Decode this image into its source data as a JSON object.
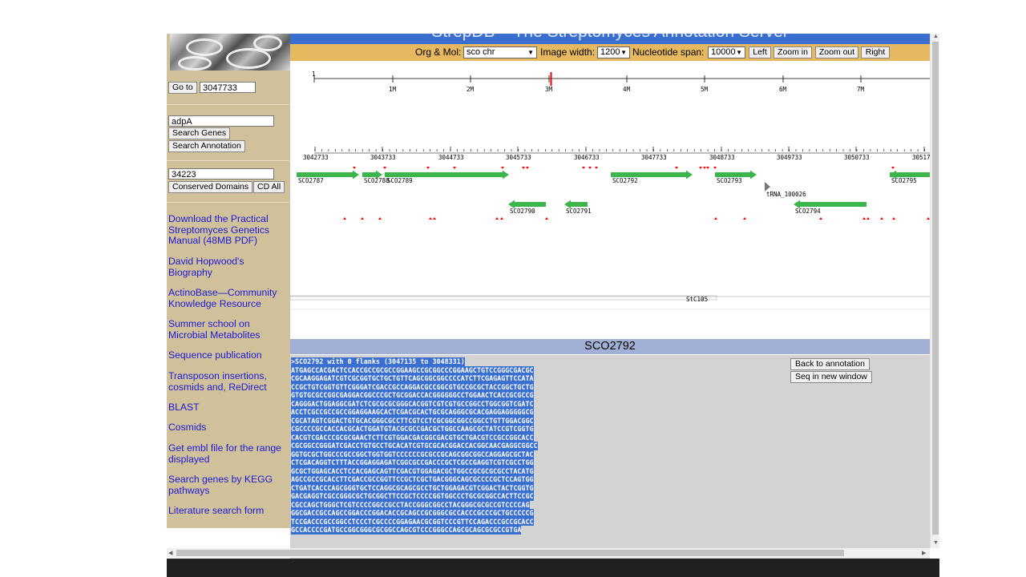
{
  "header": {
    "title": "StrepDB – The Streptomyces Annotation Server"
  },
  "controls": {
    "org_label": "Org & Mol:",
    "org_value": "sco chr",
    "width_label": "Image width:",
    "width_value": "1200",
    "span_label": "Nucleotide span:",
    "span_value": "10000",
    "left": "Left",
    "zoom_in": "Zoom in",
    "zoom_out": "Zoom out",
    "right": "Right"
  },
  "sidebar": {
    "goto_button": "Go to",
    "goto_value": "3047733",
    "gene_query": "adpA",
    "search_genes": "Search Genes",
    "search_annotation": "Search Annotation",
    "domain_query": "34223",
    "conserved_domains": "Conserved Domains",
    "cd_all": "CD All",
    "links": [
      "Download the Practical Streptomyces Genetics Manual (48MB PDF)",
      "David Hopwood's Biography",
      "ActinoBase—Community Knowledge Resource",
      "Summer school on Microbial Metabolites",
      "Sequence publication",
      "Transposon insertions, cosmids and, ReDirect",
      "BLAST",
      "Cosmids",
      "Get embl file for the range displayed",
      "Search genes by KEGG pathways",
      "Literature search form"
    ]
  },
  "genome_ruler": {
    "start_label": "1",
    "ticks": [
      "1M",
      "2M",
      "3M",
      "4M",
      "5M",
      "6M",
      "7M"
    ]
  },
  "local_ruler": {
    "ticks": [
      "3042733",
      "3043733",
      "3044733",
      "3045733",
      "3046733",
      "3047733",
      "3048733",
      "3049733",
      "3050733",
      "30517"
    ]
  },
  "genes_forward": [
    {
      "label": "SCO2787"
    },
    {
      "label": "SCO2788"
    },
    {
      "label": "SCO2789"
    },
    {
      "label": "SCO2792"
    },
    {
      "label": "SCO2793"
    },
    {
      "label": "SCO2795"
    }
  ],
  "genes_reverse": [
    {
      "label": "SCO2790"
    },
    {
      "label": "SCO2791"
    },
    {
      "label": "SCO2794"
    }
  ],
  "trna_label": "tRNA_100026",
  "cosmid_label": "StC105",
  "colors": {
    "gene": "#3cb54a",
    "marker": "#ff0000",
    "header_bar": "#3a6fd0",
    "control_bar": "#e6b85f",
    "sidebar": "#d1c19a",
    "section_bar": "#a3b0d6"
  },
  "sequence_panel": {
    "title": "SCO2792",
    "back_button": "Back to annotation",
    "new_window_button": "Seq in new window",
    "fasta_header": ">SCO2792 with 0 flanks (3047135 to 3048331)",
    "lines": [
      "ATGAGCCACGACTCCACCGCCGCGCCGGAAGCCGCGGCCCGGAAGCTGTCCGGGCGACGC",
      "CGCAAGGAGATCGTCGCGGTGCTGCTGTTCAGCGGCGGCCCCATCTTCGAGAGTTCCATA",
      "CCGCTGTCGGTGTTCGGGATCGACCGCCAGGACGCCGGCGTGCCGCGCTACCGGCTGCTG",
      "GTGTGCGCCGGCGAGGACGGCCCGCTGCGGACCACGGGGGGCCTGGAACTCACCGCGCCG",
      "CAGGGACTGGAGGCGATCTCGCGCGCGGGCACGGTCGTCGTGCCGGCCTGGCGGTCGATC",
      "ACCTCGCCGCCGCCGGAGGAAGCACTCGACGCACTGCGCAGGGCGCACGAGGAGGGGGCG",
      "CGCATAGTCGGACTGTGCACGGGCGCCTTCGTCCTCGCGGCGGCCGGCCTGTTGGACGGC",
      "CGCCCCGCCACCACGCACTGGATGTACGCGCCGACGCTGGCCAAGCGCTATCCGTCGGTG",
      "CACGTCGACCCGCGCGAACTCTTCGTGGACGACGGCGACGTGCTGACGTCCGCCGGCACC",
      "CGCGGCCGGGATCGACCTGTGCCTGCACATCGTGCGCACGGACCACGGCAACGAGGCGGCC",
      "GGTGCGCTGGCCCGCCGGCTGGTGGTCCCCCCGCGCCGCAGCGGCGGCCAGGAGCGCTAC",
      "CTCGACAGGTCTTTACCGGAGGAGATCGGCGCCGACCCGCTCGCCGAGGTCGTCGCCTGG",
      "GCGCTGGAGCACCTCCACGAGCAGTTCGACGTGGAGACGCTGGCCGCGCGCGCCTACATG",
      "AGCCGCCGCACCTTCGACCGCCGGTTCCGCTCGCTGACGGGCAGCGCCCCGCTCCAGTGG",
      "CTGATCACCCAGCGGGTGCTCCAGGCGCAGCGCCTGCTGGAGACGTCGGACTACTCGGTG",
      "GACGAGGTCGCCGGGCGCTGCGGCTTCCGCTCCCCGGTGGCCCTGCGCGGCCACTTCCGC",
      "CGCCAGCTGGGCTCGTCCCCGGCCGCCTACCGGGCGGCCTACGGGCGCGCCGTCCCCAG",
      "GGCGACCGCCAGCCGGACCCGGACACCGCAGCCGCGGGCGCCACCCGCCCGCTGCCCCCG",
      "TCCGACCCGCCGGCCTCCCTCGCCCCGGAGAACGCGGTCCCGTTCCAGACCCGCCGCACC",
      "GCCACCCCGATGCCGGCGGGCGCGGCCAGCGTCCCGGGCCAGCGCAGCGCGCCGTGA"
    ]
  }
}
